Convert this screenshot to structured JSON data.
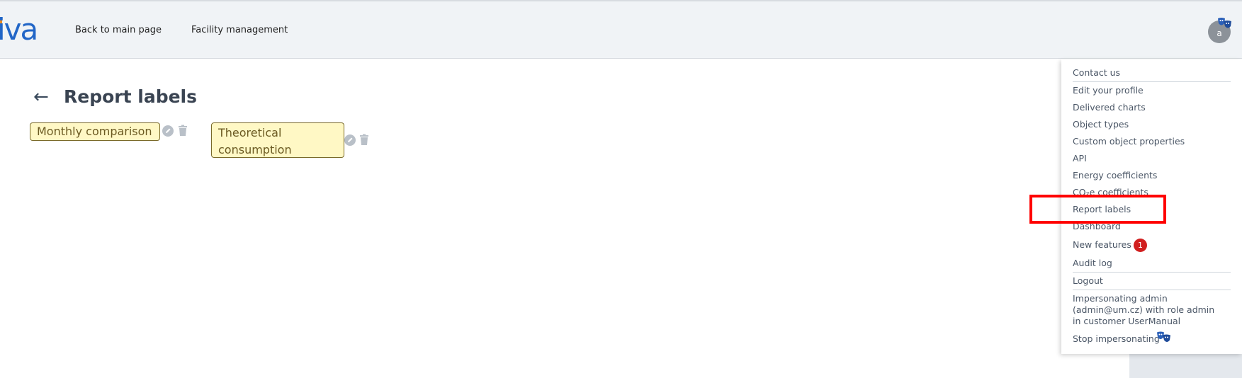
{
  "header": {
    "logo_text": "iva",
    "nav": [
      {
        "label": "Back to main page"
      },
      {
        "label": "Facility management"
      }
    ],
    "avatar_initial": "a"
  },
  "page": {
    "back_arrow": "←",
    "title": "Report labels"
  },
  "labels": [
    {
      "text": "Monthly comparison"
    },
    {
      "text": "Theoretical consumption"
    }
  ],
  "user_menu": {
    "items": [
      {
        "label": "Contact us"
      },
      {
        "label": "Edit your profile"
      },
      {
        "label": "Delivered charts"
      },
      {
        "label": "Object types"
      },
      {
        "label": "Custom object properties"
      },
      {
        "label": "API"
      },
      {
        "label": "Energy coefficients"
      },
      {
        "label": "CO₂e coefficients"
      },
      {
        "label": "Report labels"
      },
      {
        "label": "Dashboard"
      },
      {
        "label": "New features",
        "badge": "1"
      },
      {
        "label": "Audit log"
      },
      {
        "label": "Logout"
      }
    ],
    "impersonation_text": "Impersonating admin (admin@um.cz) with role admin in customer UserManual",
    "stop_impersonating": "Stop impersonating"
  },
  "colors": {
    "accent": "#2266c7",
    "highlight": "#ff0000",
    "badge": "#d11f1f",
    "chip_bg": "#fff8c5"
  },
  "icons": [
    "masks-icon",
    "pencil-icon",
    "trash-icon",
    "back-arrow-icon"
  ]
}
